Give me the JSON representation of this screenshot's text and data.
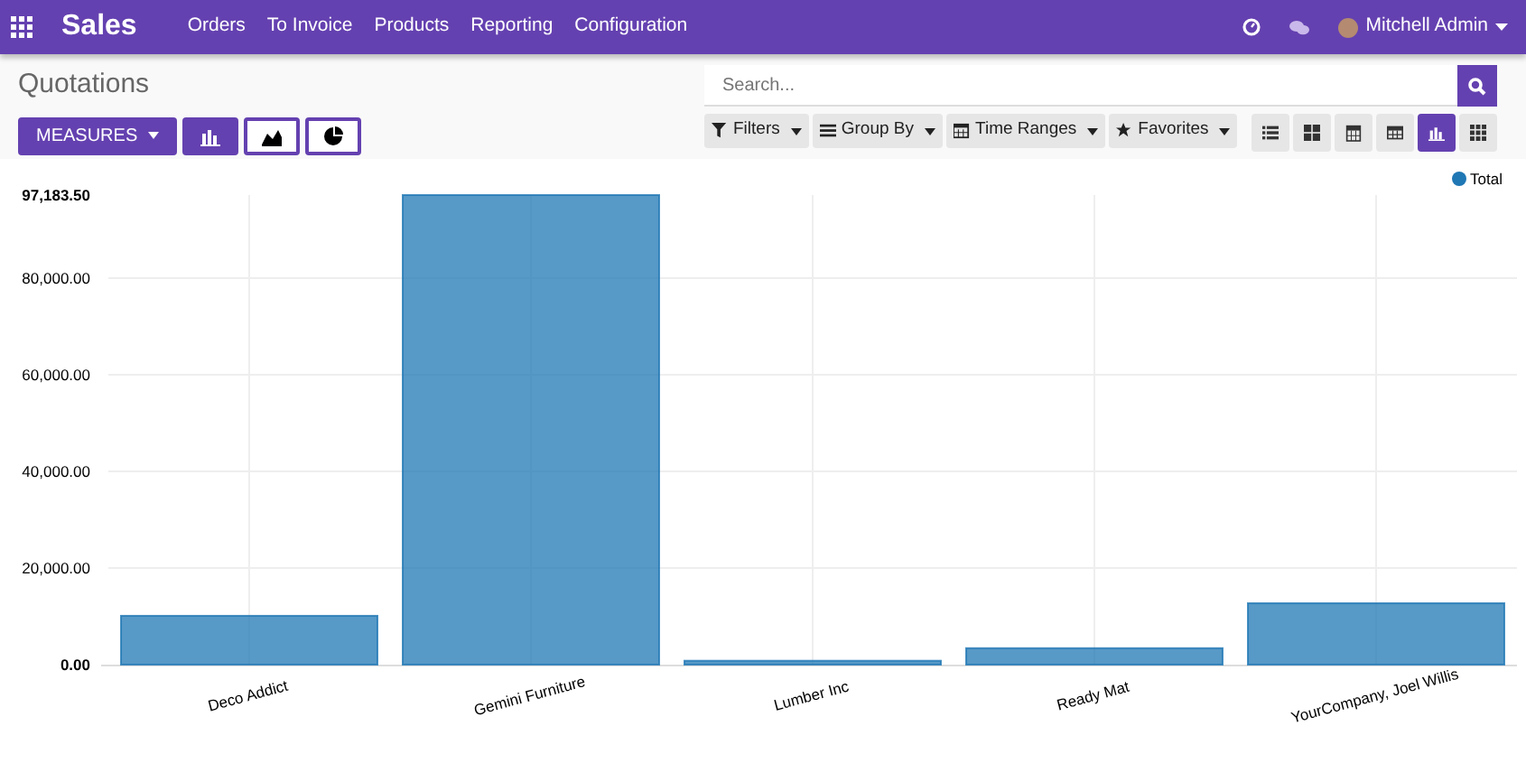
{
  "navbar": {
    "app": "Sales",
    "menu": [
      "Orders",
      "To Invoice",
      "Products",
      "Reporting",
      "Configuration"
    ],
    "user": "Mitchell Admin"
  },
  "control_panel": {
    "title": "Quotations",
    "measures": "MEASURES",
    "chart_types": [
      {
        "kind": "bar",
        "selected": true
      },
      {
        "kind": "line",
        "selected": false
      },
      {
        "kind": "pie",
        "selected": false
      }
    ],
    "search": {
      "placeholder": "Search..."
    },
    "filters": [
      {
        "kind": "filter",
        "label": "Filters"
      },
      {
        "kind": "groupby",
        "label": "Group By"
      },
      {
        "kind": "time",
        "label": "Time Ranges"
      },
      {
        "kind": "favorite",
        "label": "Favorites"
      }
    ],
    "views": [
      {
        "kind": "list",
        "selected": false
      },
      {
        "kind": "kanban",
        "selected": false
      },
      {
        "kind": "calendar",
        "selected": false
      },
      {
        "kind": "pivot",
        "selected": false
      },
      {
        "kind": "graph",
        "selected": true
      },
      {
        "kind": "grid",
        "selected": false
      }
    ]
  },
  "chart": {
    "chart_data": {
      "type": "bar",
      "categories": [
        "Deco Addict",
        "Gemini Furniture",
        "Lumber Inc",
        "Ready Mat",
        "YourCompany, Joel Willis"
      ],
      "series": [
        {
          "name": "Total",
          "color": "#1f77b4",
          "values": [
            10100,
            97183.5,
            800,
            3400,
            12700
          ]
        }
      ],
      "grid": true,
      "ylim": [
        0,
        97183.5
      ],
      "yticks": [
        {
          "value": 0,
          "label": "0.00"
        },
        {
          "value": 20000,
          "label": "20,000.00"
        },
        {
          "value": 40000,
          "label": "40,000.00"
        },
        {
          "value": 60000,
          "label": "60,000.00"
        },
        {
          "value": 80000,
          "label": "80,000.00"
        },
        {
          "value": 97183.5,
          "label": "97,183.50"
        }
      ]
    }
  }
}
